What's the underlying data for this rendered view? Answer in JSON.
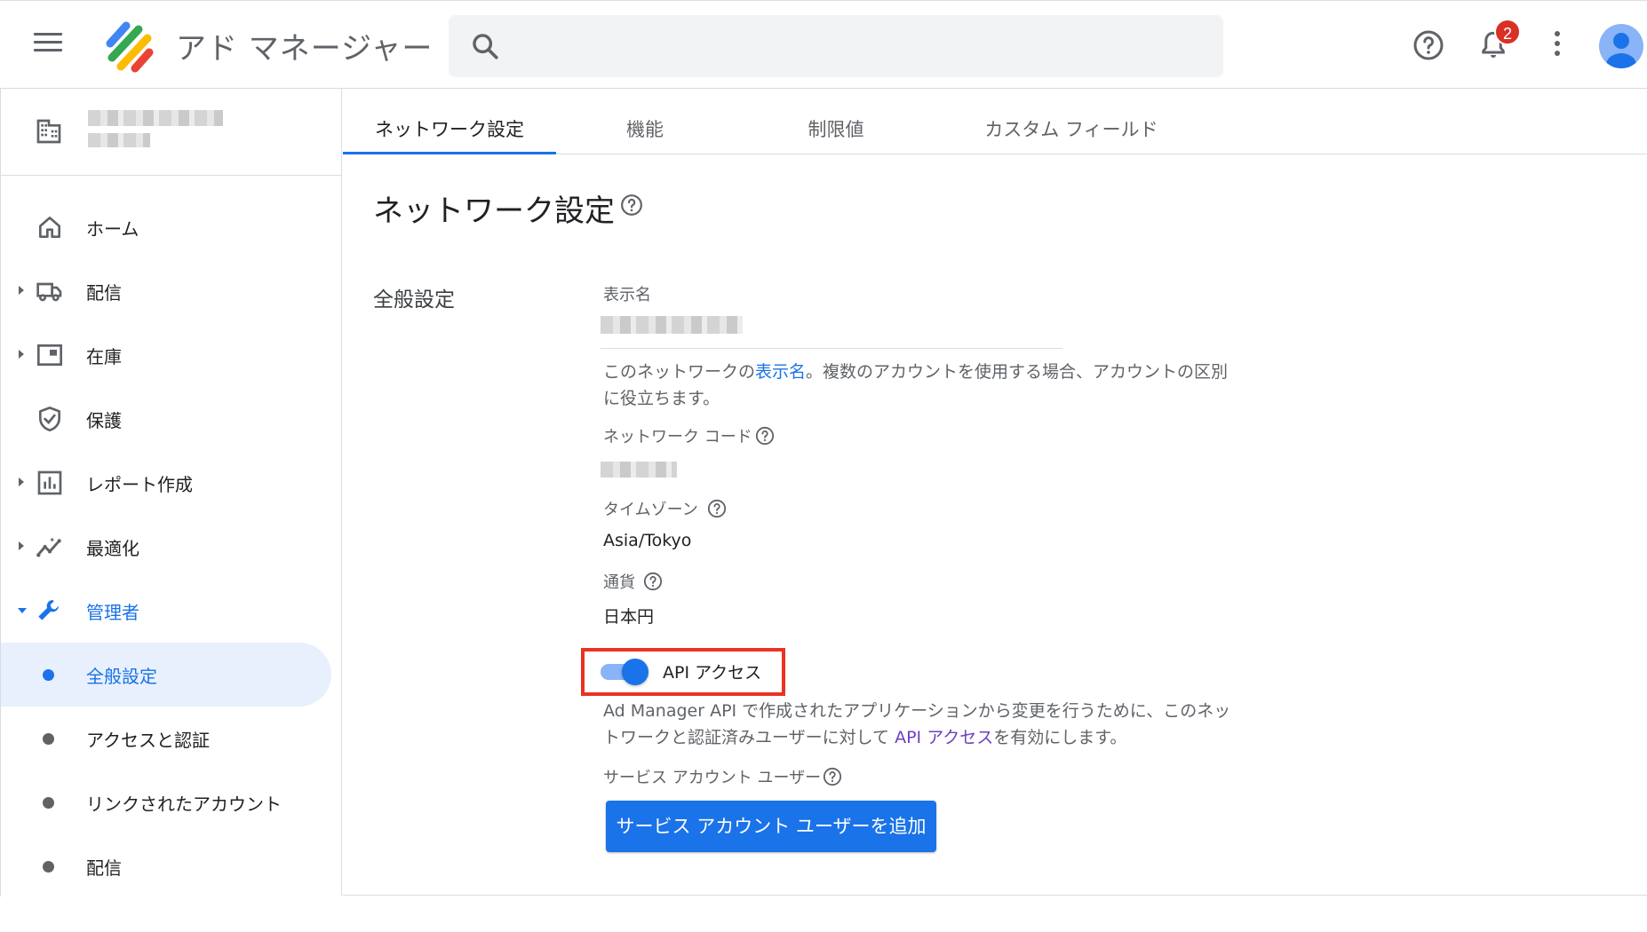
{
  "header": {
    "app_title": "アド マネージャー",
    "notification_count": "2"
  },
  "sidebar": {
    "nav": [
      {
        "label": "ホーム"
      },
      {
        "label": "配信"
      },
      {
        "label": "在庫"
      },
      {
        "label": "保護"
      },
      {
        "label": "レポート作成"
      },
      {
        "label": "最適化"
      },
      {
        "label": "管理者"
      }
    ],
    "admin_sub": [
      {
        "label": "全般設定"
      },
      {
        "label": "アクセスと認証"
      },
      {
        "label": "リンクされたアカウント"
      },
      {
        "label": "配信"
      }
    ]
  },
  "tabs": [
    {
      "label": "ネットワーク設定"
    },
    {
      "label": "機能"
    },
    {
      "label": "制限値"
    },
    {
      "label": "カスタム フィールド"
    }
  ],
  "main": {
    "page_title": "ネットワーク設定",
    "section_title": "全般設定",
    "display_name_label": "表示名",
    "display_name_desc_1": "このネットワークの",
    "display_name_desc_link": "表示名",
    "display_name_desc_2": "。複数のアカウントを使用する場合、アカウントの区別に役立ちます。",
    "network_code_label": "ネットワーク コード",
    "timezone_label": "タイムゾーン",
    "timezone_value": "Asia/Tokyo",
    "currency_label": "通貨",
    "currency_value": "日本円",
    "api_access_label": "API アクセス",
    "api_access_enabled": true,
    "api_desc_1": "Ad Manager API で作成されたアプリケーションから変更を行うために、このネットワークと認証済みユーザーに対して ",
    "api_desc_link": "API アクセス",
    "api_desc_2": "を有効にします。",
    "service_account_label": "サービス アカウント ユーザー",
    "add_service_account_button": "サービス アカウント ユーザーを追加"
  },
  "colors": {
    "accent": "#1a73e8",
    "highlight_box": "#ea3323",
    "badge": "#d93025"
  }
}
